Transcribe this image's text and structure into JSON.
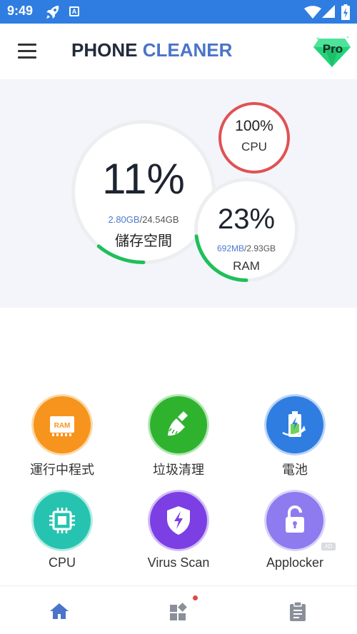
{
  "status_bar": {
    "time": "9:49",
    "a_badge": "A"
  },
  "header": {
    "title_part1": "PHONE",
    "title_part2": "CLEANER",
    "pro_label": "Pro"
  },
  "dashboard": {
    "storage": {
      "percent": "11%",
      "used": "2.80GB",
      "total": "/24.54GB",
      "label": "儲存空間",
      "usage_fraction": 0.11
    },
    "cpu": {
      "percent": "100%",
      "label": "CPU",
      "usage_fraction": 1.0
    },
    "ram": {
      "percent": "23%",
      "used": "692MB",
      "total": "/2.93GB",
      "label": "RAM",
      "usage_fraction": 0.23
    }
  },
  "features": [
    {
      "label": "運行中程式",
      "icon": "ram-chip-icon",
      "color": "#f7941d",
      "icon_text": "RAM"
    },
    {
      "label": "垃圾清理",
      "icon": "broom-icon",
      "color": "#2fb32f"
    },
    {
      "label": "電池",
      "icon": "battery-charging-icon",
      "color": "#2f7de1"
    },
    {
      "label": "CPU",
      "icon": "cpu-chip-icon",
      "color": "#26c4b0"
    },
    {
      "label": "Virus Scan",
      "icon": "shield-lightning-icon",
      "color": "#7b3fe4"
    },
    {
      "label": "Applocker",
      "icon": "padlock-icon",
      "color": "#8e7bef",
      "badge": "AD"
    }
  ],
  "bottom_nav": [
    {
      "name": "home",
      "icon": "home-icon",
      "active": true
    },
    {
      "name": "apps",
      "icon": "grid-icon",
      "has_notification": true
    },
    {
      "name": "report",
      "icon": "clipboard-icon"
    }
  ],
  "colors": {
    "status_bar": "#2f7de1",
    "accent": "#4a74c9",
    "title_dark": "#222b3a",
    "cpu_ring": "#e05252",
    "progress_green": "#1fbf5a"
  }
}
